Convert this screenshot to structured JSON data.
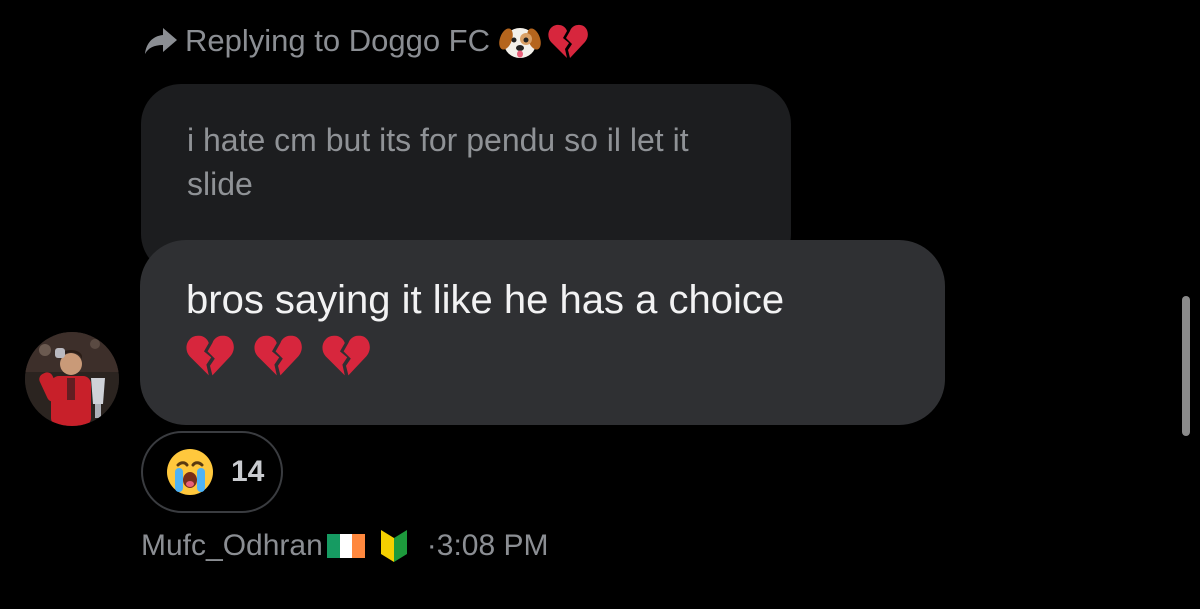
{
  "reply": {
    "label": "Replying to Doggo FC",
    "icons": [
      "reply-arrow-icon",
      "dog-face-emoji",
      "broken-heart-emoji"
    ]
  },
  "quoted_message": {
    "text": "i hate cm but its for pendu so il let it slide"
  },
  "message": {
    "text": "bros saying it like he has a choice",
    "emojis": [
      "broken-heart-emoji",
      "broken-heart-emoji",
      "broken-heart-emoji"
    ]
  },
  "reaction": {
    "emoji": "loudly-crying-face-emoji",
    "count": "14"
  },
  "meta": {
    "username": "Mufc_Odhran",
    "badges": [
      "ireland-flag-emoji",
      "japanese-beginner-symbol-emoji"
    ],
    "time": "·3:08 PM"
  },
  "colors": {
    "background": "#000000",
    "quoted_bubble": "#1c1d1f",
    "message_bubble": "#2f3033",
    "secondary_text": "#8b8e93",
    "primary_text": "#f2f2f3"
  }
}
